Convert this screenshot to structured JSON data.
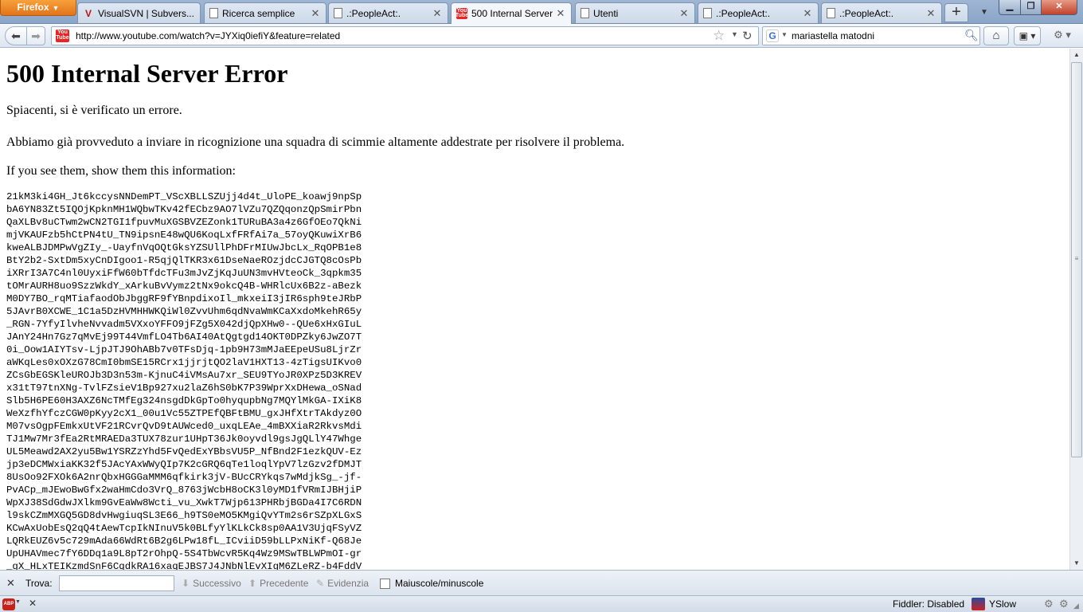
{
  "browser": {
    "menu_button": "Firefox",
    "tabs": [
      {
        "title": "VisualSVN | Subvers...",
        "icon": "svn-icon"
      },
      {
        "title": "Ricerca semplice",
        "icon": "page-icon"
      },
      {
        "title": ".:PeopleAct:.",
        "icon": "page-icon"
      },
      {
        "title": "500 Internal Server ...",
        "icon": "youtube-icon",
        "active": true
      },
      {
        "title": "Utenti",
        "icon": "page-icon"
      },
      {
        "title": ".:PeopleAct:.",
        "icon": "page-icon"
      },
      {
        "title": ".:PeopleAct:.",
        "icon": "page-icon"
      }
    ],
    "new_tab": "+",
    "url": "http://www.youtube.com/watch?v=JYXiq0iefiY&feature=related",
    "youtube_favicon": {
      "line1": "You",
      "line2": "Tube"
    },
    "search_engine": "G",
    "search_text": "mariastella matodni",
    "accent_color": "#e2731b"
  },
  "page": {
    "title": "500 Internal Server Error",
    "para1": "Spiacenti, si è verificato un errore.",
    "para2": "Abbiamo già provveduto a inviare in ricognizione una squadra di scimmie altamente addestrate per risolvere il problema.",
    "para3": "If you see them, show them this information:",
    "code_lines": [
      "21kM3ki4GH_Jt6kccysNNDemPT_VScXBLLSZUjj4d4t_UloPE_koawj9npSp",
      "bA6YN83Zt5IQOjKpknMH1WQbwTKv42fECbz9AO7lVZu7QZQqonzQpSmirPbn",
      "QaXLBv8uCTwm2wCN2TGI1fpuvMuXGSBVZEZonk1TURuBA3a4z6GfOEo7QkNi",
      "mjVKAUFzb5hCtPN4tU_TN9ipsnE48wQU6KoqLxfFRfAi7a_57oyQKuwiXrB6",
      "kweALBJDMPwVgZIy_-UayfnVqOQtGksYZSUllPhDFrMIUwJbcLx_RqOPB1e8",
      "BtY2b2-SxtDm5xyCnDIgoo1-R5qjQlTKR3x61DseNaeROzjdcCJGTQ8cOsPb",
      "iXRrI3A7C4nl0UyxiFfW60bTfdcTFu3mJvZjKqJuUN3mvHVteoCk_3qpkm35",
      "tOMrAURH8uo9SzzWkdY_xArkuBvVymz2tNx9okcQ4B-WHRlcUx6B2z-aBezk",
      "M0DY7BO_rqMTiafaodObJbggRF9fYBnpdixoIl_mkxeiI3jIR6sph9teJRbP",
      "5JAvrB0XCWE_1C1a5DzHVMHHWKQiWl0ZvvUhm6qdNvaWmKCaXxdoMkehR65y",
      "_RGN-7YfyIlvheNvvadm5VXxoYFFO9jFZg5X042djQpXHw0--QUe6xHxGIuL",
      "JAnY24Hn7Gz7qMvEj99T44VmfLO4Tb6AI40AtQgtgd14OKT0DPZky6JwZO7T",
      "0i_Oow1AIYTsv-LjpJTJ9OhABb7v0TFsDjq-1pb9H73mMJaEEpeUSu8LjrZr",
      "aWKqLes0xOXzG78CmI0bmSE15RCrx1jjrjtQO2laV1HXT13-4zTigsUIKvo0",
      "ZCsGbEGSKleUROJb3D3n53m-KjnuC4iVMsAu7xr_SEU9TYoJR0XPz5D3KREV",
      "x31tT97tnXNg-TvlFZsieV1Bp927xu2laZ6hS0bK7P39WprXxDHewa_oSNad",
      "Slb5H6PE60H3AXZ6NcTMfEg324nsgdDkGpTo0hyqupbNg7MQYlMkGA-IXiK8",
      "WeXzfhYfczCGW0pKyy2cX1_00u1Vc55ZTPEfQBFtBMU_gxJHfXtrTAkdyz0O",
      "M07vsOgpFEmkxUtVF21RCvrQvD9tAUWced0_uxqLEAe_4mBXXiaR2RkvsMdi",
      "TJ1Mw7Mr3fEa2RtMRAEDa3TUX78zur1UHpT36Jk0oyvdl9gsJgQLlY47Whge",
      "UL5Meawd2AX2yu5Bw1YSRZzYhd5FvQedExYBbsVU5P_NfBnd2F1ezkQUV-Ez",
      "jp3eDCMWxiaKK32f5JAcYAxWWyQIp7K2cGRQ6qTe1loqlYpV7lzGzv2fDMJT",
      "8UsOo92FXOk6A2nrQbxHGGGaMMM6qfkirk3jV-BUcCRYkqs7wMdjkSg_-jf-",
      "PvACp_mJEwoBwGfx2waHmCdo3VrQ_8763jWcbH8oCK3l0yMD1fVRmIJBHjiP",
      "WpXJ38SdGdwJXlkm9GvEaWw8Wcti_vu_XwkT7Wjp613PHRbjBGDa4I7C6RDN",
      "l9skCZmMXGQ5GD8dvHwgiuqSL3E66_h9TS0eMO5KMgiQvYTm2s6rSZpXLGxS",
      "KCwAxUobEsQ2qQ4tAewTcpIkNInuV5k0BLfyYlKLkCk8sp0AA1V3UjqFSyVZ",
      "LQRkEUZ6v5c729mAda66WdRt6B2g6LPw18fL_ICviiD59bLLPxNiKf-Q68Je",
      "UpUHAVmec7fY6DDq1a9L8pT2rOhpQ-5S4TbWcvR5Kq4Wz9MSwTBLWPmOI-gr",
      "_gX_HLxTEIKzmdSnF6CqdkRA16xaqEJBS7J4JNbNlEvXIgM6ZLeRZ-b4FddV"
    ]
  },
  "findbar": {
    "label": "Trova:",
    "value": "",
    "next": "Successivo",
    "prev": "Precedente",
    "highlight": "Evidenzia",
    "match_case": "Maiuscole/minuscole"
  },
  "statusbar": {
    "abp": "ABP",
    "fiddler": "Fiddler: Disabled",
    "yslow": "YSlow"
  }
}
